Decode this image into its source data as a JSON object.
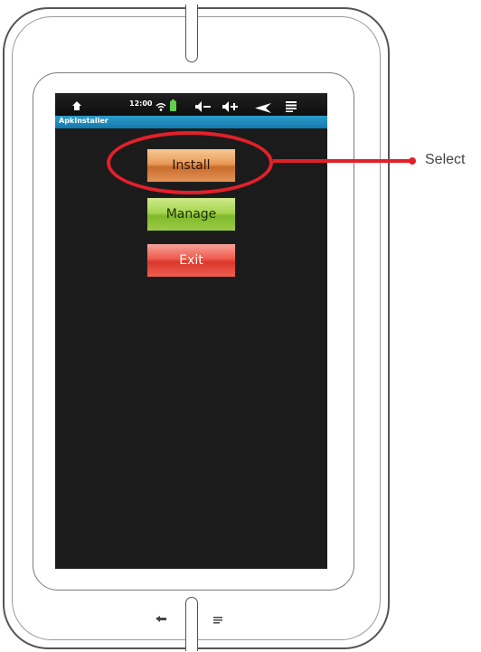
{
  "status_bar": {
    "time": "12:00",
    "icons": [
      "home-icon",
      "wifi-icon",
      "battery-icon",
      "volume-down-icon",
      "volume-up-icon",
      "back-icon",
      "menu-icon"
    ]
  },
  "app": {
    "title": "ApkInstaller"
  },
  "buttons": {
    "install": "Install",
    "manage": "Manage",
    "exit": "Exit"
  },
  "hardware": {
    "icons": [
      "back-icon",
      "menu-icon"
    ]
  },
  "annotation": {
    "label": "Select",
    "color": "#e3202a"
  },
  "colors": {
    "install": "#e99a57",
    "manage": "#a6d54f",
    "exit": "#ef5a4b",
    "title_bar": "#2b9cc9"
  }
}
